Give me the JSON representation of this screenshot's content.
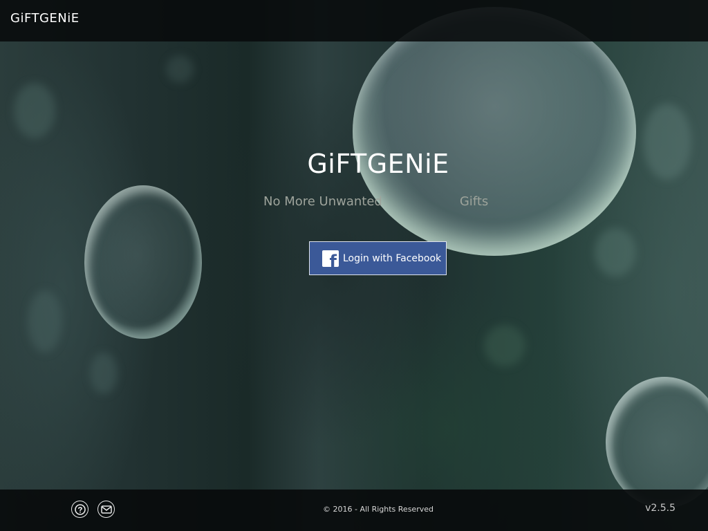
{
  "header": {
    "brand": "GiFTGENiE"
  },
  "hero": {
    "title": "GiFTGENiE",
    "tagline_left": "No More Unwanted",
    "tagline_right": "Gifts",
    "login_button_label": "Login with Facebook",
    "login_icon": "facebook-icon"
  },
  "footer": {
    "help_icon": "question-circle-icon",
    "mail_icon": "envelope-icon",
    "copyright": "© 2016 - All Rights Reserved",
    "version": "v2.5.5"
  },
  "colors": {
    "topbar": "#080a0b",
    "facebook_blue": "#3b5998",
    "tagline": "#9da39b",
    "text_white": "#ffffff"
  }
}
